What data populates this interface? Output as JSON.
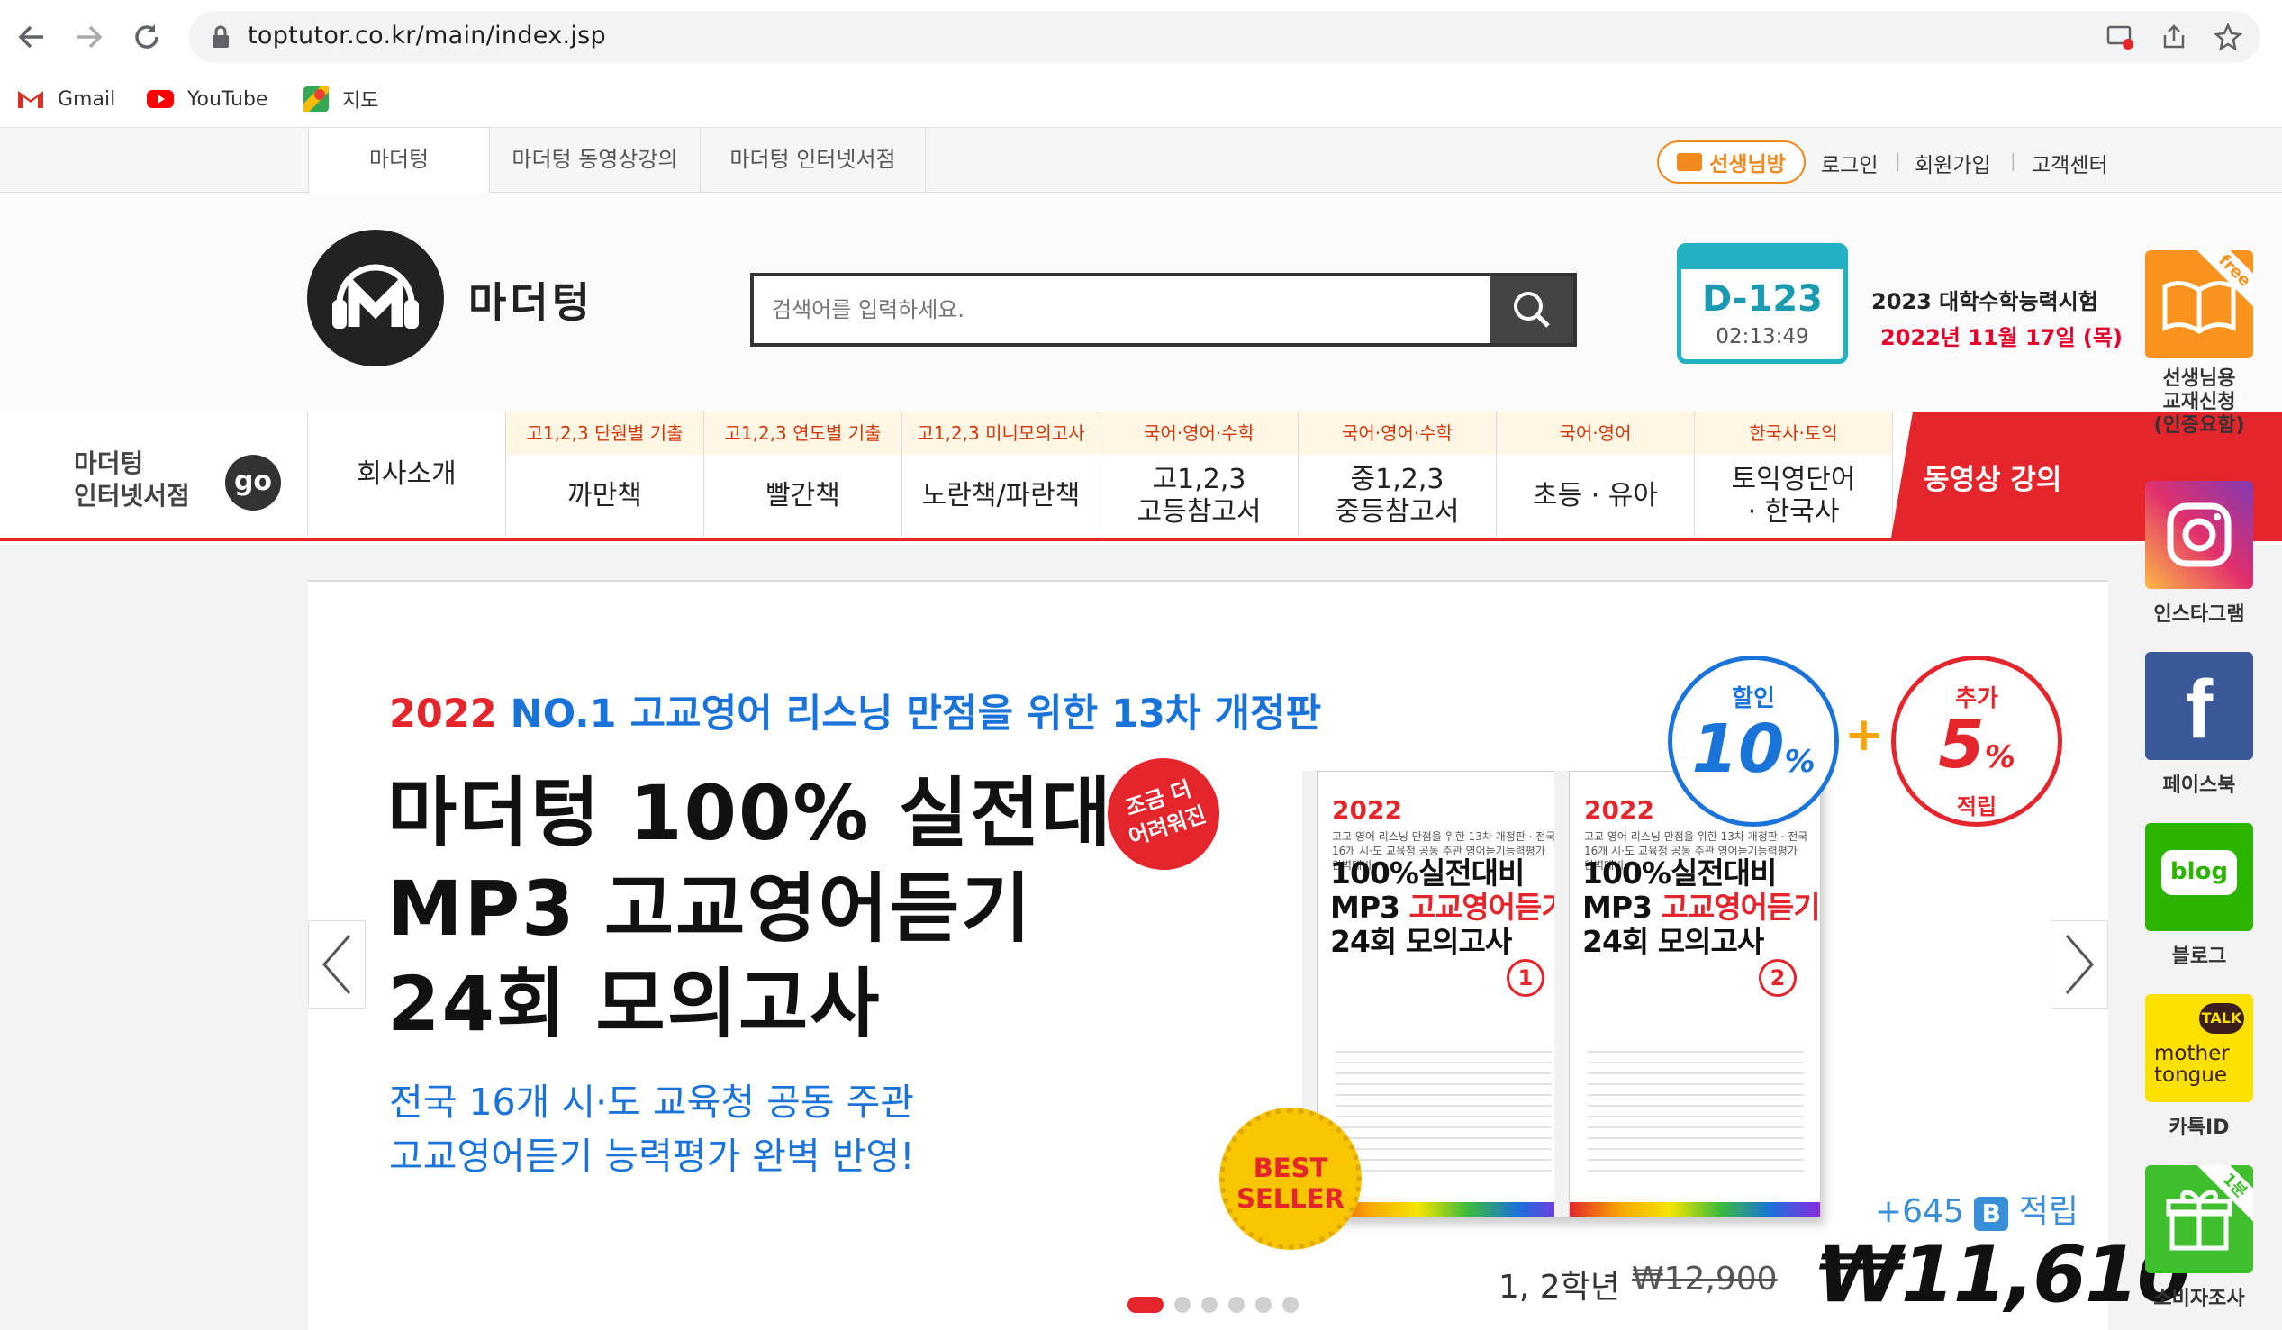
{
  "browser": {
    "url": "toptutor.co.kr/main/index.jsp",
    "bookmarks": [
      {
        "label": "Gmail",
        "icon": "gmail-icon"
      },
      {
        "label": "YouTube",
        "icon": "youtube-icon"
      },
      {
        "label": "지도",
        "icon": "maps-icon"
      }
    ]
  },
  "topbar": {
    "tabs": [
      "마더텅",
      "마더텅 동영상강의",
      "마더텅 인터넷서점"
    ],
    "teacher": "선생님방",
    "links": [
      "로그인",
      "회원가입",
      "고객센터"
    ]
  },
  "header": {
    "logo": "마더텅",
    "search_placeholder": "검색어를 입력하세요.",
    "dday": "D-123",
    "dday_time": "02:13:49",
    "exam_title": "2023 대학수학능력시험",
    "exam_date": "2022년 11월 17일 (목)"
  },
  "nav": {
    "store_line1": "마더텅",
    "store_line2": "인터넷서점",
    "go": "go",
    "company": "회사소개",
    "categories": [
      {
        "sub": "고1,2,3 단원별 기출",
        "main": "까만책"
      },
      {
        "sub": "고1,2,3 연도별 기출",
        "main": "빨간책"
      },
      {
        "sub": "고1,2,3 미니모의고사",
        "main": "노란책/파란책"
      },
      {
        "sub": "국어·영어·수학",
        "main": "고1,2,3\n고등참고서"
      },
      {
        "sub": "국어·영어·수학",
        "main": "중1,2,3\n중등참고서"
      },
      {
        "sub": "국어·영어",
        "main": "초등 · 유아"
      },
      {
        "sub": "한국사·토익",
        "main": "토익영단어\n· 한국사"
      }
    ],
    "video": "동영상 강의"
  },
  "banner": {
    "headline_red": "2022",
    "headline_blue": "NO.1 고교영어 리스닝 만점을 위한 13차 개정판",
    "title1": "마더텅 100% 실전대비",
    "title2": "MP3 고교영어듣기",
    "title3": "24회 모의고사",
    "sub1": "전국 16개 시·도 교육청 공동 주관",
    "sub2": "고교영어듣기 능력평가 완벽 반영!",
    "bubble": "조금 더\n어려워진",
    "book_year": "2022",
    "book_title1": "100%실전대비",
    "book_title2_black": "MP3 ",
    "book_title2_red": "고교영어듣기",
    "book_title3": "24회 모의고사",
    "book_small": "고교 영어 리스닝 만점을 위한 13차 개정판 · 전국 16개 시·도 교육청 공동 주관 영어듣기능력평가 완벽대비",
    "book_vol1": "1",
    "book_vol2": "2",
    "best_seller": "BEST\nSELLER",
    "discount_label": "할인",
    "discount_value": "10",
    "discount_unit": "%",
    "extra_label": "추가",
    "extra_value": "5",
    "extra_unit": "%",
    "extra_sub": "적립",
    "points_value": "+645",
    "points_badge": "B",
    "points_suffix": "적립",
    "grade": "1, 2학년",
    "original_price": "₩12,900",
    "sale_price": "₩11,610",
    "slide_count": 6,
    "active_slide": 0
  },
  "quick_menu": {
    "free_tag": "free",
    "one_tag": "1분",
    "labels": [
      "선생님용\n교재신청\n(인증요함)",
      "인스타그램",
      "페이스북",
      "블로그",
      "카톡ID",
      "소비자조사"
    ],
    "talk": "TALK",
    "kakao_text1": "mother",
    "kakao_text2": "tongue",
    "blog_text": "blog",
    "fb_letter": "f"
  },
  "colors": {
    "brand_red": "#e4262c",
    "accent_orange": "#f08a1c",
    "accent_teal": "#22b0c3",
    "accent_blue": "#1a73d9"
  }
}
